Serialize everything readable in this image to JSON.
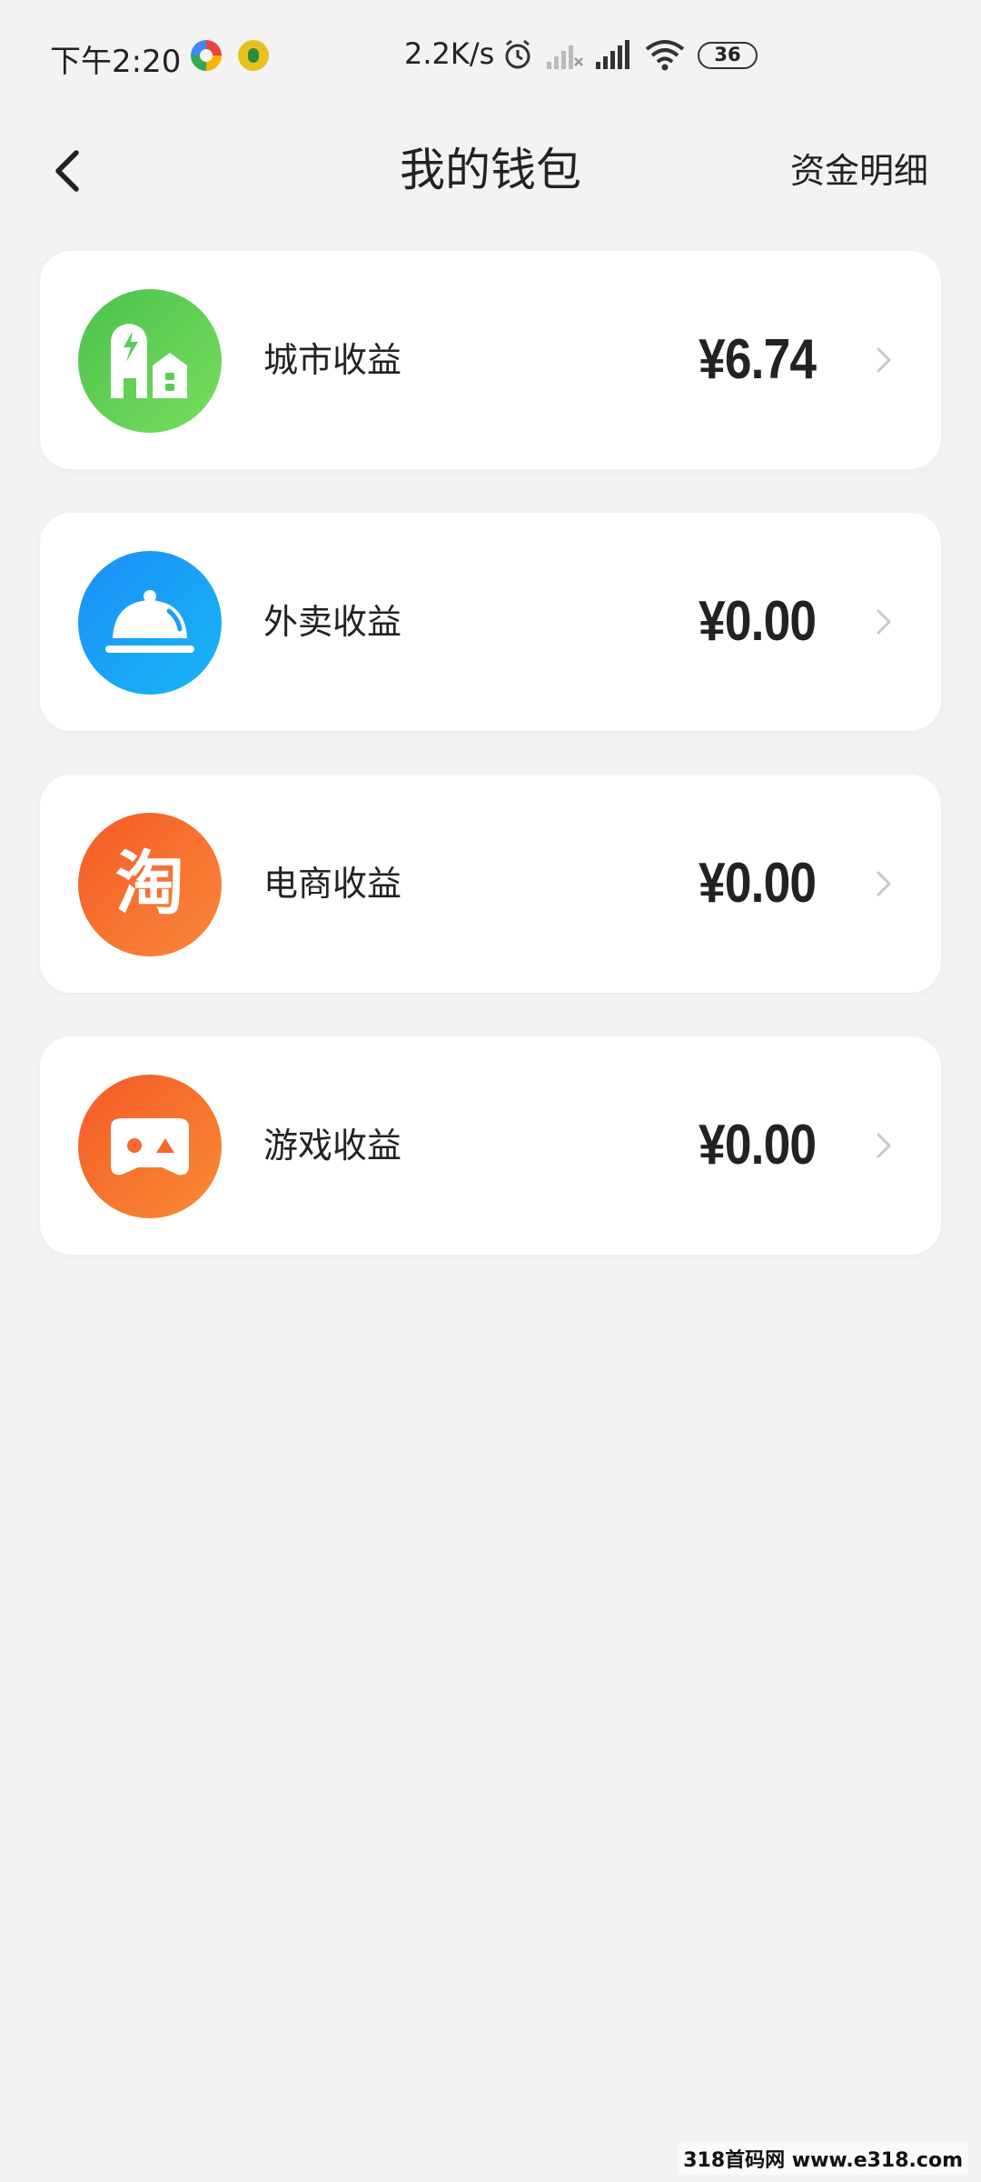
{
  "status_bar": {
    "time": "下午2:20",
    "net_speed": "2.2K/s",
    "battery": "36"
  },
  "header": {
    "back_icon": "chevron-left-icon",
    "title": "我的钱包",
    "detail_link": "资金明细"
  },
  "wallet_items": [
    {
      "label": "城市收益",
      "amount": "¥6.74",
      "icon": "city-building-icon",
      "color": "#58cc5a"
    },
    {
      "label": "外卖收益",
      "amount": "¥0.00",
      "icon": "food-cloche-icon",
      "color": "#1b9bf5"
    },
    {
      "label": "电商收益",
      "amount": "¥0.00",
      "icon": "taobao-icon",
      "color": "#f56a2a"
    },
    {
      "label": "游戏收益",
      "amount": "¥0.00",
      "icon": "game-mask-icon",
      "color": "#f5692a"
    }
  ],
  "watermark": "318首码网 www.e318.com"
}
